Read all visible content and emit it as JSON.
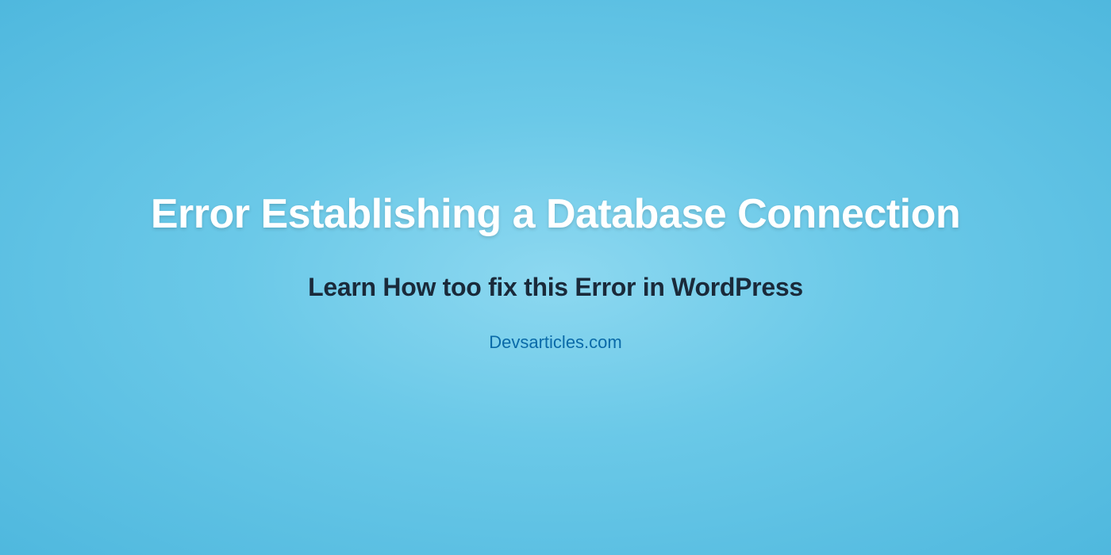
{
  "hero": {
    "title": "Error Establishing a Database Connection",
    "subtitle": "Learn How too fix this Error in WordPress",
    "website": "Devsarticles.com"
  }
}
